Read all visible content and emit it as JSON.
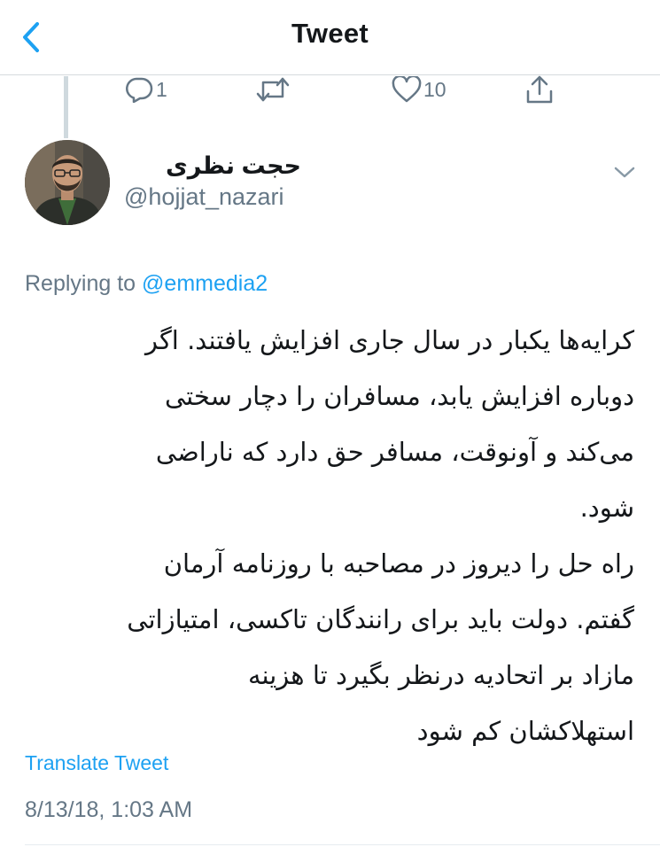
{
  "header": {
    "title": "Tweet",
    "back_icon": "chevron-left-icon",
    "accent_color": "#1da1f2"
  },
  "actions": {
    "reply_count": "1",
    "retweet_count": "",
    "like_count": "10",
    "icons": [
      "reply-icon",
      "retweet-icon",
      "like-icon",
      "share-icon"
    ]
  },
  "author": {
    "display_name": "حجت نظری",
    "handle": "@hojjat_nazari"
  },
  "reply": {
    "prefix": "Replying to ",
    "mention": "@emmedia2"
  },
  "tweet": {
    "text": "کرایه‌ها یکبار در سال جاری افزایش یافتند. اگر\nدوباره افزایش یابد، مسافران را دچار سختی\nمی‌کند و آونوقت، مسافر حق دارد که ناراضی\nشود.\nراه حل را دیروز در مصاحبه با روزنامه آرمان\nگفتم. دولت باید برای رانندگان تاکسی، امتیازاتی\nمازاد بر اتحادیه درنظر بگیرد تا هزینه\nاستهلاکشان کم شود",
    "translate_label": "Translate Tweet",
    "timestamp": "8/13/18, 1:03 AM"
  }
}
